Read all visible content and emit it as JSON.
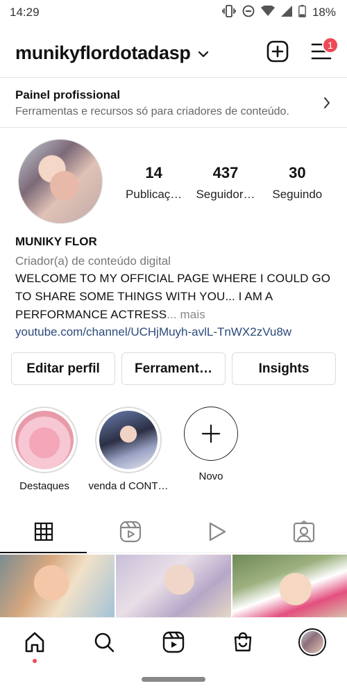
{
  "status_bar": {
    "time": "14:29",
    "battery": "18%"
  },
  "header": {
    "username": "munikyflordotadasp",
    "notification_count": "1"
  },
  "pro_panel": {
    "title": "Painel profissional",
    "subtitle": "Ferramentas e recursos só para criadores de conteúdo."
  },
  "stats": [
    {
      "value": "14",
      "label": "Publicaç…"
    },
    {
      "value": "437",
      "label": "Seguidor…"
    },
    {
      "value": "30",
      "label": "Seguindo"
    }
  ],
  "bio": {
    "name": "MUNIKY FLOR",
    "category": "Criador(a) de conteúdo digital",
    "text": "WELCOME TO MY OFFICIAL PAGE WHERE I COULD GO TO SHARE SOME THINGS WITH YOU... I AM A PERFORMANCE ACTRESS",
    "more": "... mais",
    "link": "youtube.com/channel/UCHjMuyh-avlL-TnWX2zVu8w"
  },
  "buttons": {
    "edit": "Editar perfil",
    "tools": "Ferrament…",
    "insights": "Insights"
  },
  "highlights": [
    {
      "label": "Destaques"
    },
    {
      "label": "venda d CONT…"
    },
    {
      "label": "Novo"
    }
  ],
  "tabs": [
    "grid-icon",
    "reels-icon",
    "play-icon",
    "tagged-icon"
  ],
  "bottom_nav": [
    "home-icon",
    "search-icon",
    "reels-icon",
    "shop-icon",
    "profile-avatar"
  ],
  "colors": {
    "badge": "#ed4956",
    "link": "#2b4a7a",
    "muted": "#777777"
  }
}
